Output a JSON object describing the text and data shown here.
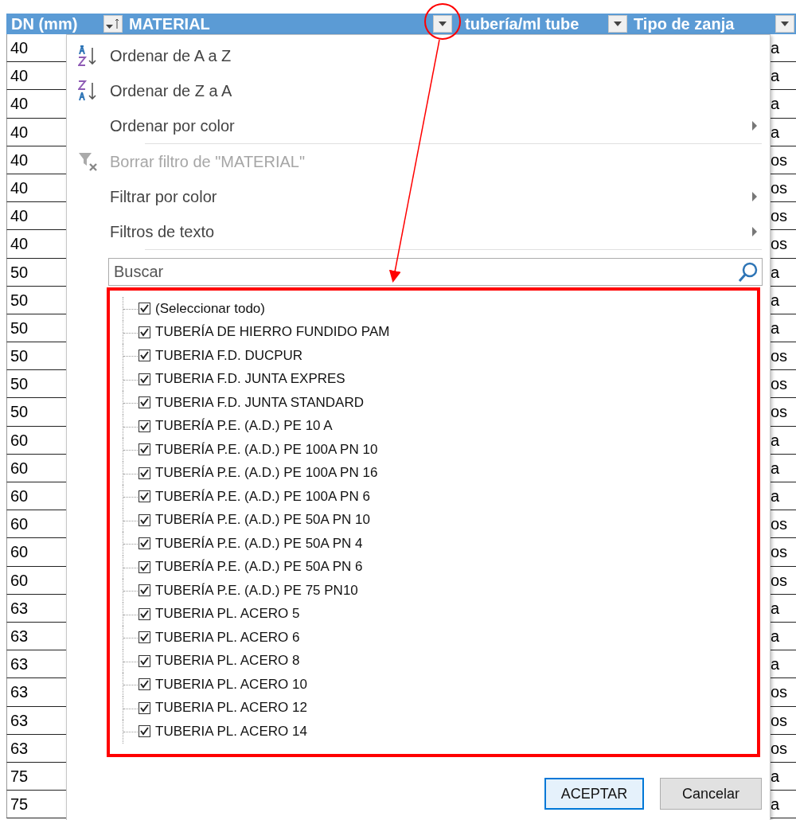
{
  "columns": [
    {
      "label": "DN (mm)",
      "kind": "sort"
    },
    {
      "label": "MATERIAL",
      "kind": "dropdown"
    },
    {
      "label": "tubería/ml tube",
      "kind": "dropdown"
    },
    {
      "label": "Tipo de zanja",
      "kind": "dropdown"
    }
  ],
  "rows": [
    {
      "dn": "40",
      "tail": "a"
    },
    {
      "dn": "40",
      "tail": "a"
    },
    {
      "dn": "40",
      "tail": "a"
    },
    {
      "dn": "40",
      "tail": "a"
    },
    {
      "dn": "40",
      "tail": "os"
    },
    {
      "dn": "40",
      "tail": "os"
    },
    {
      "dn": "40",
      "tail": "os"
    },
    {
      "dn": "40",
      "tail": "os"
    },
    {
      "dn": "50",
      "tail": "a"
    },
    {
      "dn": "50",
      "tail": "a"
    },
    {
      "dn": "50",
      "tail": "a"
    },
    {
      "dn": "50",
      "tail": "os"
    },
    {
      "dn": "50",
      "tail": "os"
    },
    {
      "dn": "50",
      "tail": "os"
    },
    {
      "dn": "60",
      "tail": "a"
    },
    {
      "dn": "60",
      "tail": "a"
    },
    {
      "dn": "60",
      "tail": "a"
    },
    {
      "dn": "60",
      "tail": "os"
    },
    {
      "dn": "60",
      "tail": "os"
    },
    {
      "dn": "60",
      "tail": "os"
    },
    {
      "dn": "63",
      "tail": "a"
    },
    {
      "dn": "63",
      "tail": "a"
    },
    {
      "dn": "63",
      "tail": "a"
    },
    {
      "dn": "63",
      "tail": "os"
    },
    {
      "dn": "63",
      "tail": "os"
    },
    {
      "dn": "63",
      "tail": "os"
    },
    {
      "dn": "75",
      "tail": "a"
    },
    {
      "dn": "75",
      "tail": "a"
    }
  ],
  "filter_menu": {
    "items": [
      {
        "kind": "sort-asc",
        "label": "Ordenar de A a Z",
        "disabled": false
      },
      {
        "kind": "sort-desc",
        "label": "Ordenar de Z a A",
        "disabled": false
      },
      {
        "kind": "submenu",
        "label": "Ordenar por color",
        "disabled": false
      },
      {
        "kind": "separator"
      },
      {
        "kind": "clear-filter",
        "label": "Borrar filtro de \"MATERIAL\"",
        "disabled": true
      },
      {
        "kind": "submenu",
        "label": "Filtrar por color",
        "disabled": false
      },
      {
        "kind": "submenu",
        "label": "Filtros de texto",
        "disabled": false
      },
      {
        "kind": "separator"
      }
    ],
    "search": {
      "placeholder": "Buscar"
    },
    "values": [
      {
        "label": "(Seleccionar todo)",
        "checked": true
      },
      {
        "label": "TUBERÍA DE HIERRO FUNDIDO PAM",
        "checked": true
      },
      {
        "label": "TUBERIA F.D. DUCPUR",
        "checked": true
      },
      {
        "label": "TUBERIA F.D. JUNTA EXPRES",
        "checked": true
      },
      {
        "label": "TUBERIA F.D. JUNTA STANDARD",
        "checked": true
      },
      {
        "label": "TUBERÍA P.E. (A.D.) PE 10 A",
        "checked": true
      },
      {
        "label": "TUBERÍA P.E. (A.D.) PE 100A PN 10",
        "checked": true
      },
      {
        "label": "TUBERÍA P.E. (A.D.) PE 100A PN 16",
        "checked": true
      },
      {
        "label": "TUBERÍA P.E. (A.D.) PE 100A PN 6",
        "checked": true
      },
      {
        "label": "TUBERÍA P.E. (A.D.) PE 50A PN 10",
        "checked": true
      },
      {
        "label": "TUBERÍA P.E. (A.D.) PE 50A PN 4",
        "checked": true
      },
      {
        "label": "TUBERÍA P.E. (A.D.) PE 50A PN 6",
        "checked": true
      },
      {
        "label": "TUBERÍA P.E. (A.D.) PE 75 PN10",
        "checked": true
      },
      {
        "label": "TUBERIA PL. ACERO  5",
        "checked": true
      },
      {
        "label": "TUBERIA PL. ACERO  6",
        "checked": true
      },
      {
        "label": "TUBERIA PL. ACERO  8",
        "checked": true
      },
      {
        "label": "TUBERIA PL. ACERO 10",
        "checked": true
      },
      {
        "label": "TUBERIA PL. ACERO 12",
        "checked": true
      },
      {
        "label": "TUBERIA PL. ACERO 14",
        "checked": true
      }
    ],
    "buttons": [
      {
        "label": "ACEPTAR",
        "default": true
      },
      {
        "label": "Cancelar",
        "default": false
      }
    ]
  }
}
